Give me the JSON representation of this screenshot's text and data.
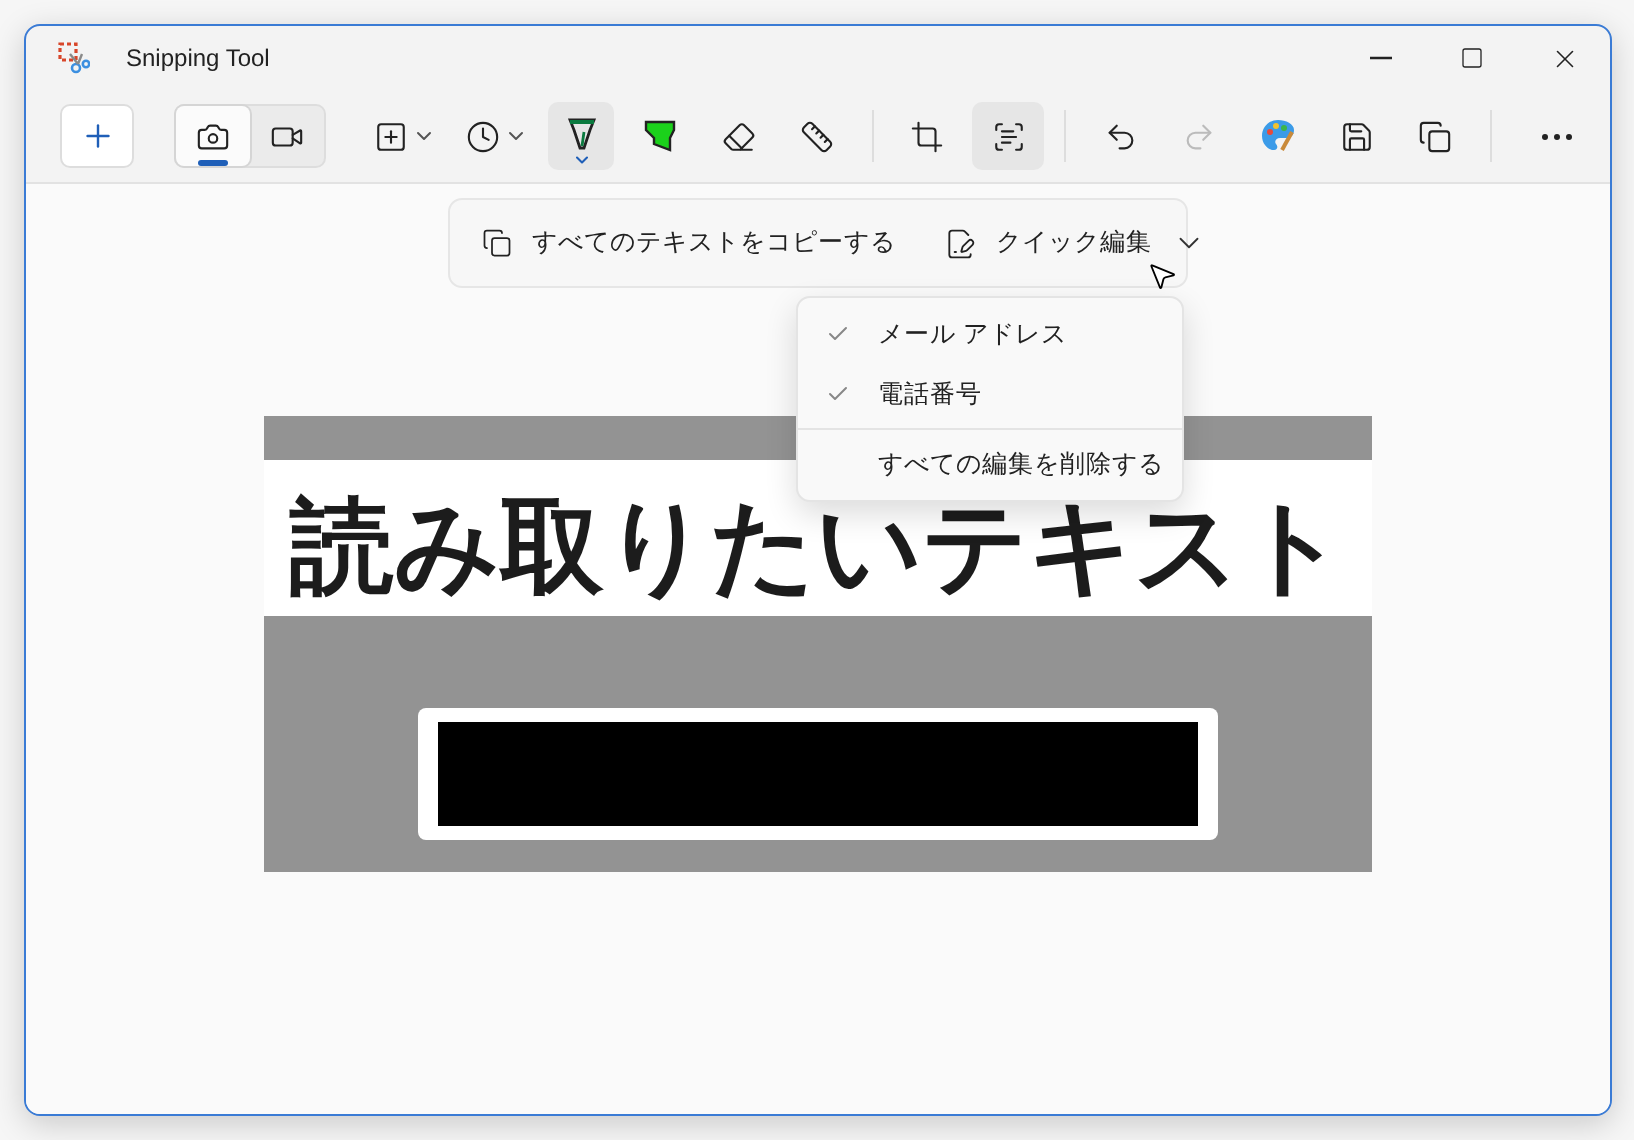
{
  "window": {
    "title": "Snipping Tool",
    "controls": [
      {
        "kind": "minimize"
      },
      {
        "kind": "maximize"
      },
      {
        "kind": "close"
      }
    ]
  },
  "toolbar": {
    "items": [
      {
        "kind": "new",
        "active": false
      },
      {
        "kind": "separator-gap"
      },
      {
        "kind": "mode-photo",
        "selected": true
      },
      {
        "kind": "mode-video",
        "selected": false
      },
      {
        "kind": "separator-gap"
      },
      {
        "kind": "shape",
        "active": false
      },
      {
        "kind": "timer",
        "active": false
      },
      {
        "kind": "pen",
        "active": true
      },
      {
        "kind": "highlighter",
        "active": false
      },
      {
        "kind": "eraser",
        "active": false
      },
      {
        "kind": "ruler",
        "active": false
      },
      {
        "kind": "separator"
      },
      {
        "kind": "crop",
        "active": false
      },
      {
        "kind": "text-actions",
        "active": true
      },
      {
        "kind": "separator"
      },
      {
        "kind": "undo",
        "active": false,
        "disabled": false
      },
      {
        "kind": "redo",
        "active": false,
        "disabled": true
      },
      {
        "kind": "paint",
        "active": false
      },
      {
        "kind": "save",
        "active": false
      },
      {
        "kind": "copy",
        "active": false
      },
      {
        "kind": "separator"
      },
      {
        "kind": "more",
        "active": false
      }
    ]
  },
  "text_actions": {
    "copy_all": "すべてのテキストをコピーする",
    "quick_edit": "クイック編集",
    "expanded": true
  },
  "quick_edit_menu": {
    "items": [
      {
        "label": "メール アドレス",
        "checked": true
      },
      {
        "label": "電話番号",
        "checked": true
      }
    ],
    "remove_all": "すべての編集を削除する"
  },
  "capture": {
    "heading": "読み取りたいテキスト",
    "redacted": true
  }
}
